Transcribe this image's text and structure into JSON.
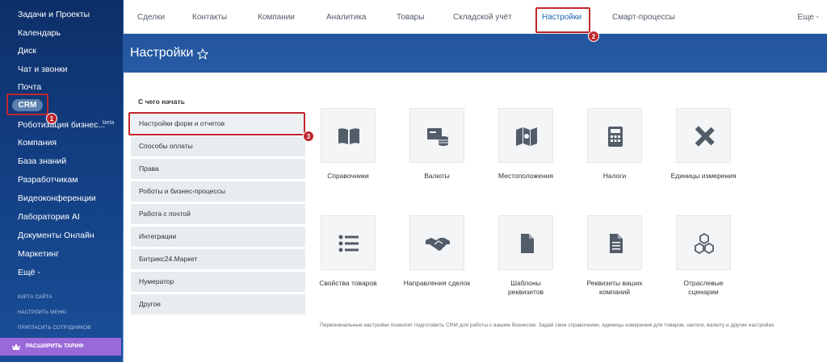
{
  "sidebar": {
    "items": [
      {
        "label": "Задачи и Проекты"
      },
      {
        "label": "Календарь"
      },
      {
        "label": "Диск"
      },
      {
        "label": "Чат и звонки"
      },
      {
        "label": "Почта"
      },
      {
        "label": "CRM"
      },
      {
        "label": "Роботизация бизнес..."
      },
      {
        "label": "Компания"
      },
      {
        "label": "База знаний"
      },
      {
        "label": "Разработчикам"
      },
      {
        "label": "Видеоконференции"
      },
      {
        "label": "Лаборатория AI"
      },
      {
        "label": "Документы Онлайн"
      },
      {
        "label": "Маркетинг"
      },
      {
        "label": "Ещё -"
      }
    ],
    "beta_label": "beta",
    "small_links": [
      "КАРТА САЙТА",
      "НАСТРОИТЬ МЕНЮ",
      "ПРИГЛАСИТЬ СОТРУДНИКОВ"
    ],
    "upgrade_label": "РАСШИРИТЬ ТАРИФ"
  },
  "topnav": {
    "tabs": [
      "Сделки",
      "Контакты",
      "Компании",
      "Аналитика",
      "Товары",
      "Складской учёт",
      "Настройки",
      "Смарт-процессы"
    ],
    "more": "Еще -"
  },
  "page": {
    "title": "Настройки"
  },
  "settings_menu": {
    "title": "С чего начать",
    "items": [
      "Настройки форм и отчетов",
      "Способы оплаты",
      "Права",
      "Роботы и бизнес-процессы",
      "Работа с почтой",
      "Интеграции",
      "Битрикс24.Маркет",
      "Нумератор",
      "Другое"
    ]
  },
  "tiles": [
    {
      "label": "Справочники",
      "icon": "book-icon"
    },
    {
      "label": "Валюты",
      "icon": "currency-icon"
    },
    {
      "label": "Местоположения",
      "icon": "map-icon"
    },
    {
      "label": "Налоги",
      "icon": "calculator-icon"
    },
    {
      "label": "Единицы измерения",
      "icon": "ruler-pencil-icon"
    },
    {
      "label": "Свойства товаров",
      "icon": "list-icon"
    },
    {
      "label": "Направления сделок",
      "icon": "handshake-icon"
    },
    {
      "label": "Шаблоны реквизитов",
      "icon": "document-icon"
    },
    {
      "label": "Реквизиты ваших компаний",
      "icon": "document-text-icon"
    },
    {
      "label": "Отраслевые сценарии",
      "icon": "cubes-icon"
    }
  ],
  "footnote": "Первоначальные настройки позволят подготовить CRM для работы с вашим бизнесом. Задай свои справочники, единицы измерения для товаров, налоги, валюту и другие настройки.",
  "annotations": [
    "1",
    "2",
    "3"
  ],
  "colors": {
    "highlight": "#c0272d",
    "active_tab": "#2067b0",
    "upgrade": "#9a69d9"
  }
}
